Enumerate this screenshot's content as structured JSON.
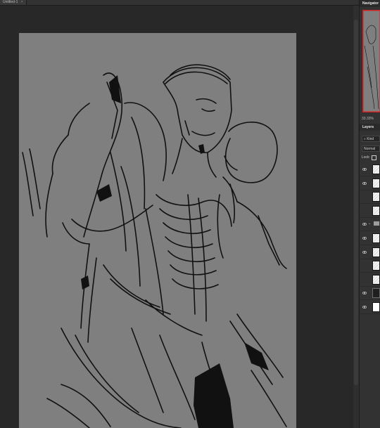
{
  "document": {
    "tab_label": "Untitled-1",
    "close_glyph": "×"
  },
  "panels": {
    "navigator": {
      "title": "Navigator",
      "zoom": "33.33%"
    },
    "layers": {
      "title": "Layers",
      "kind_filter": "Kind",
      "blend_mode": "Normal",
      "lock_label": "Lock:",
      "eye_glyph": "👁",
      "folder_chevron": "⌄",
      "rows": [
        {
          "visible": true,
          "thumb": "sketch"
        },
        {
          "visible": true,
          "thumb": "sketch"
        },
        {
          "visible": false,
          "thumb": "sketch"
        },
        {
          "visible": false,
          "thumb": "sketch"
        },
        {
          "visible": true,
          "thumb": "group"
        },
        {
          "visible": true,
          "thumb": "sketch"
        },
        {
          "visible": true,
          "thumb": "sketch"
        },
        {
          "visible": false,
          "thumb": "sketch"
        },
        {
          "visible": false,
          "thumb": "sketch"
        },
        {
          "visible": true,
          "thumb": "dark"
        },
        {
          "visible": true,
          "thumb": "white"
        }
      ]
    }
  },
  "colors": {
    "workspace": "#282828",
    "canvas": "#7f7f7f",
    "ink": "#111111",
    "navigator_frame": "#d62020"
  },
  "icons": [
    "eye-icon",
    "search-icon",
    "lock-icon",
    "folder-icon",
    "chevron-down-icon"
  ]
}
